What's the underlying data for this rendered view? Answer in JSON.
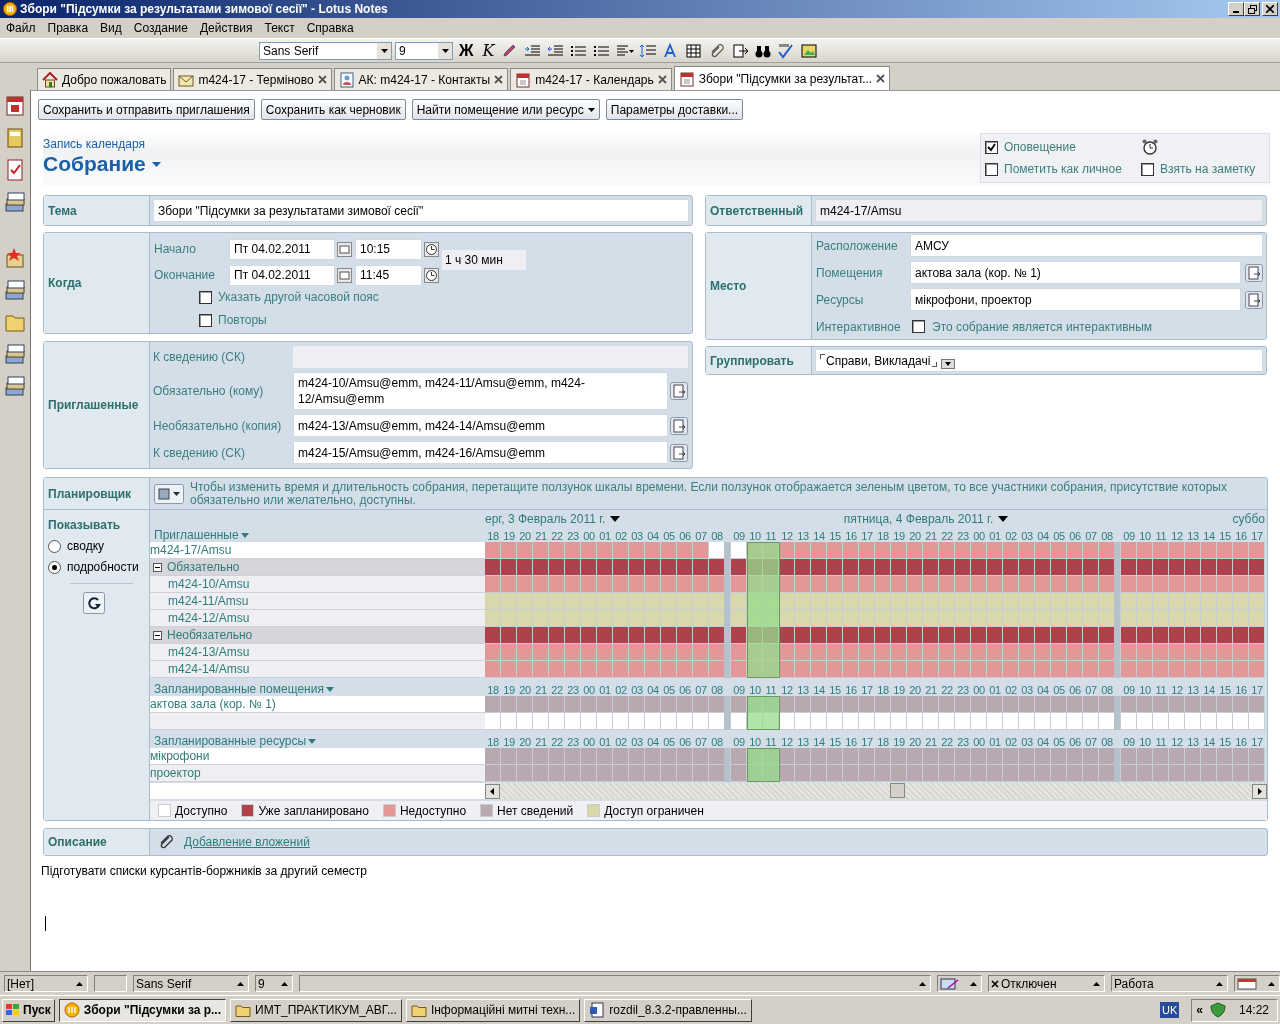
{
  "window": {
    "title": "Збори \"Підсумки за результатами зимової сесії\" - Lotus Notes"
  },
  "menu": [
    "Файл",
    "Правка",
    "Вид",
    "Создание",
    "Действия",
    "Текст",
    "Справка"
  ],
  "toolbar": {
    "font": "Sans Serif",
    "size": "9",
    "bold": "Ж",
    "italic": "K"
  },
  "tabs": [
    {
      "label": "Добро пожаловать",
      "kind": "home",
      "closable": false,
      "selected": false
    },
    {
      "label": "m424-17 - Терміново",
      "kind": "mail",
      "closable": true,
      "selected": false
    },
    {
      "label": "АК: m424-17 - Контакты",
      "kind": "contacts",
      "closable": true,
      "selected": false
    },
    {
      "label": "m424-17 - Календарь",
      "kind": "calendar",
      "closable": true,
      "selected": false
    },
    {
      "label": "Збори \"Підсумки за результат...",
      "kind": "calendar",
      "closable": true,
      "selected": true
    }
  ],
  "actions": [
    {
      "label": "Сохранить и отправить приглашения",
      "dropdown": false
    },
    {
      "label": "Сохранить как черновик",
      "dropdown": false
    },
    {
      "label": "Найти помещение или ресурс",
      "dropdown": true
    },
    {
      "label": "Параметры доставки...",
      "dropdown": false
    }
  ],
  "header": {
    "category": "Запись календаря",
    "title": "Собрание"
  },
  "options": [
    {
      "label": "Оповещение",
      "checked": true,
      "alarm": true
    },
    {
      "label": "Пометить как личное",
      "checked": false,
      "alarm": false
    },
    {
      "label": "Взять на заметку",
      "checked": false,
      "alarm": false
    }
  ],
  "subject": {
    "label": "Тема",
    "value": "Збори \"Підсумки за результатами зимової сесії\""
  },
  "when": {
    "label": "Когда",
    "rows": [
      {
        "label": "Начало",
        "date": "Пт 04.02.2011",
        "time": "10:15"
      },
      {
        "label": "Окончание",
        "date": "Пт 04.02.2011",
        "time": "11:45"
      }
    ],
    "duration": "1 ч 30 мин",
    "checks": [
      {
        "label": "Указать другой часовой пояс",
        "checked": false
      },
      {
        "label": "Повторы",
        "checked": false
      }
    ]
  },
  "invitees": {
    "label": "Приглашенные",
    "fields": [
      {
        "label": "К сведению (СК)",
        "kind": "readonly"
      },
      {
        "label": "Обязательно (кому)",
        "kind": "address",
        "value": "m424-10/Amsu@emm, m424-11/Amsu@emm, m424-12/Amsu@emm"
      },
      {
        "label": "Необязательно (копия)",
        "kind": "address",
        "value": "m424-13/Amsu@emm, m424-14/Amsu@emm"
      },
      {
        "label": "К сведению (СК)",
        "kind": "address",
        "value": "m424-15/Amsu@emm, m424-16/Amsu@emm"
      }
    ]
  },
  "chair": {
    "label": "Ответственный",
    "value": "m424-17/Amsu"
  },
  "location": {
    "label": "Место",
    "fields": [
      {
        "label": "Расположение",
        "kind": "text",
        "value": "АМСУ"
      },
      {
        "label": "Помещения",
        "kind": "address",
        "value": "актова зала (кор. № 1)"
      },
      {
        "label": "Ресурсы",
        "kind": "address",
        "value": "мікрофони, проектор"
      },
      {
        "label": "Интерактивное",
        "kind": "checkbox",
        "value": "Это собрание является интерактивным",
        "checked": false
      }
    ]
  },
  "category": {
    "label": "Группировать",
    "value": "Справи, Викладачі"
  },
  "scheduler": {
    "label": "Планировщик",
    "hint": "Чтобы изменить время и длительность собрания, перетащите ползунок шкалы времени.  Если ползунок отображается зеленым цветом, то все участники собрания, присутствие которых обязательно или желательно, доступны.",
    "show": {
      "label": "Показывать",
      "options": [
        {
          "label": "сводку",
          "selected": false
        },
        {
          "label": "подробности",
          "selected": true
        }
      ]
    },
    "dates": [
      {
        "label": "ерг, 3 Февраль 2011 г.",
        "menu": true
      },
      {
        "label": "пятница, 4 Февраль 2011 г.",
        "menu": true
      },
      {
        "label": "суббо",
        "menu": false
      }
    ],
    "slider": {
      "on": true
    },
    "sections": [
      {
        "title": "Приглашенные",
        "hours": [
          [
            "18",
            "19",
            "20",
            "21",
            "22",
            "23",
            "00",
            "01",
            "02",
            "03",
            "04",
            "05",
            "06",
            "07",
            "08"
          ],
          [
            "09",
            "10",
            "11",
            "12",
            "13",
            "14",
            "15",
            "16",
            "17",
            "18",
            "19",
            "20",
            "21",
            "22",
            "23",
            "00",
            "01",
            "02",
            "03",
            "04",
            "05",
            "06",
            "07",
            "08"
          ],
          [
            "09",
            "10",
            "11",
            "12",
            "13",
            "14",
            "15",
            "16",
            "17"
          ]
        ],
        "rows": [
          {
            "name": "m424-17/Amsu",
            "kind": "entry",
            "color": "#e39798",
            "free_before_meeting": true
          },
          {
            "name": "Обязательно",
            "kind": "group",
            "expanded": true,
            "color": "#ae414b"
          },
          {
            "name": "m424-10/Amsu",
            "kind": "member",
            "color": "#e39798"
          },
          {
            "name": "m424-11/Amsu",
            "kind": "member",
            "color": "#d9d8ad"
          },
          {
            "name": "m424-12/Amsu",
            "kind": "member",
            "color": "#d9d8ad"
          },
          {
            "name": "Необязательно",
            "kind": "group",
            "expanded": true,
            "color": "#ae414b"
          },
          {
            "name": "m424-13/Amsu",
            "kind": "member",
            "color": "#e39798"
          },
          {
            "name": "m424-14/Amsu",
            "kind": "member",
            "color": "#e39798"
          }
        ]
      },
      {
        "title": "Запланированные помещения",
        "hours": [
          [
            "18",
            "19",
            "20",
            "21",
            "22",
            "23",
            "00",
            "01",
            "02",
            "03",
            "04",
            "05",
            "06",
            "07",
            "08"
          ],
          [
            "09",
            "10",
            "11",
            "12",
            "13",
            "14",
            "15",
            "16",
            "17",
            "18",
            "19",
            "20",
            "21",
            "22",
            "23",
            "00",
            "01",
            "02",
            "03",
            "04",
            "05",
            "06",
            "07",
            "08"
          ],
          [
            "09",
            "10",
            "11",
            "12",
            "13",
            "14",
            "15",
            "16",
            "17"
          ]
        ],
        "rows": [
          {
            "name": "актова зала (кор. № 1)",
            "kind": "entry",
            "color": "#b8a9b1"
          },
          {
            "kind": "entry",
            "color": "#ffffff"
          }
        ]
      },
      {
        "title": "Запланированные ресурсы",
        "hours": [
          [
            "18",
            "19",
            "20",
            "21",
            "22",
            "23",
            "00",
            "01",
            "02",
            "03",
            "04",
            "05",
            "06",
            "07",
            "08"
          ],
          [
            "09",
            "10",
            "11",
            "12",
            "13",
            "14",
            "15",
            "16",
            "17",
            "18",
            "19",
            "20",
            "21",
            "22",
            "23",
            "00",
            "01",
            "02",
            "03",
            "04",
            "05",
            "06",
            "07",
            "08"
          ],
          [
            "09",
            "10",
            "11",
            "12",
            "13",
            "14",
            "15",
            "16",
            "17"
          ]
        ],
        "rows": [
          {
            "name": "мікрофони",
            "kind": "entry",
            "color": "#b8a9b1"
          },
          {
            "name": "проектор",
            "kind": "entry",
            "color": "#b8a9b1"
          }
        ]
      }
    ],
    "legend": [
      {
        "label": "Доступно",
        "color": "#ffffff"
      },
      {
        "label": "Уже запланировано",
        "color": "#ae414b"
      },
      {
        "label": "Недоступно",
        "color": "#e39798"
      },
      {
        "label": "Нет сведений",
        "color": "#b8a9b1"
      },
      {
        "label": "Доступ ограничен",
        "color": "#d9d8ad"
      }
    ]
  },
  "description": {
    "label": "Описание",
    "link": "Добавление вложений"
  },
  "body": "Підготувати списки курсантів-боржників за другий семестр",
  "status_bar": {
    "location": "[Нет]",
    "font": "Sans Serif",
    "size": "9",
    "connection": "Отключен",
    "place": "Работа"
  },
  "taskbar": {
    "start": "Пуск",
    "tasks": [
      {
        "label": "Збори \"Підсумки за р...",
        "kind": "notes",
        "selected": true
      },
      {
        "label": "ИМТ_ПРАКТИКУМ_АВГ...",
        "kind": "folder",
        "selected": false
      },
      {
        "label": "Інформаційні митні техн...",
        "kind": "folder",
        "selected": false
      },
      {
        "label": "rozdil_8.3.2-правленны...",
        "kind": "word",
        "selected": false
      }
    ],
    "language": "UK",
    "expand": "«",
    "time": "14:22"
  }
}
